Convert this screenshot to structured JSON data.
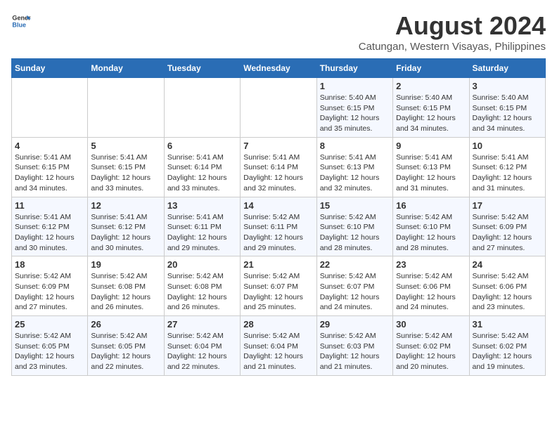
{
  "header": {
    "logo_general": "General",
    "logo_blue": "Blue",
    "title": "August 2024",
    "subtitle": "Catungan, Western Visayas, Philippines"
  },
  "calendar": {
    "days_of_week": [
      "Sunday",
      "Monday",
      "Tuesday",
      "Wednesday",
      "Thursday",
      "Friday",
      "Saturday"
    ],
    "weeks": [
      [
        {
          "day": "",
          "info": ""
        },
        {
          "day": "",
          "info": ""
        },
        {
          "day": "",
          "info": ""
        },
        {
          "day": "",
          "info": ""
        },
        {
          "day": "1",
          "info": "Sunrise: 5:40 AM\nSunset: 6:15 PM\nDaylight: 12 hours\nand 35 minutes."
        },
        {
          "day": "2",
          "info": "Sunrise: 5:40 AM\nSunset: 6:15 PM\nDaylight: 12 hours\nand 34 minutes."
        },
        {
          "day": "3",
          "info": "Sunrise: 5:40 AM\nSunset: 6:15 PM\nDaylight: 12 hours\nand 34 minutes."
        }
      ],
      [
        {
          "day": "4",
          "info": "Sunrise: 5:41 AM\nSunset: 6:15 PM\nDaylight: 12 hours\nand 34 minutes."
        },
        {
          "day": "5",
          "info": "Sunrise: 5:41 AM\nSunset: 6:15 PM\nDaylight: 12 hours\nand 33 minutes."
        },
        {
          "day": "6",
          "info": "Sunrise: 5:41 AM\nSunset: 6:14 PM\nDaylight: 12 hours\nand 33 minutes."
        },
        {
          "day": "7",
          "info": "Sunrise: 5:41 AM\nSunset: 6:14 PM\nDaylight: 12 hours\nand 32 minutes."
        },
        {
          "day": "8",
          "info": "Sunrise: 5:41 AM\nSunset: 6:13 PM\nDaylight: 12 hours\nand 32 minutes."
        },
        {
          "day": "9",
          "info": "Sunrise: 5:41 AM\nSunset: 6:13 PM\nDaylight: 12 hours\nand 31 minutes."
        },
        {
          "day": "10",
          "info": "Sunrise: 5:41 AM\nSunset: 6:12 PM\nDaylight: 12 hours\nand 31 minutes."
        }
      ],
      [
        {
          "day": "11",
          "info": "Sunrise: 5:41 AM\nSunset: 6:12 PM\nDaylight: 12 hours\nand 30 minutes."
        },
        {
          "day": "12",
          "info": "Sunrise: 5:41 AM\nSunset: 6:12 PM\nDaylight: 12 hours\nand 30 minutes."
        },
        {
          "day": "13",
          "info": "Sunrise: 5:41 AM\nSunset: 6:11 PM\nDaylight: 12 hours\nand 29 minutes."
        },
        {
          "day": "14",
          "info": "Sunrise: 5:42 AM\nSunset: 6:11 PM\nDaylight: 12 hours\nand 29 minutes."
        },
        {
          "day": "15",
          "info": "Sunrise: 5:42 AM\nSunset: 6:10 PM\nDaylight: 12 hours\nand 28 minutes."
        },
        {
          "day": "16",
          "info": "Sunrise: 5:42 AM\nSunset: 6:10 PM\nDaylight: 12 hours\nand 28 minutes."
        },
        {
          "day": "17",
          "info": "Sunrise: 5:42 AM\nSunset: 6:09 PM\nDaylight: 12 hours\nand 27 minutes."
        }
      ],
      [
        {
          "day": "18",
          "info": "Sunrise: 5:42 AM\nSunset: 6:09 PM\nDaylight: 12 hours\nand 27 minutes."
        },
        {
          "day": "19",
          "info": "Sunrise: 5:42 AM\nSunset: 6:08 PM\nDaylight: 12 hours\nand 26 minutes."
        },
        {
          "day": "20",
          "info": "Sunrise: 5:42 AM\nSunset: 6:08 PM\nDaylight: 12 hours\nand 26 minutes."
        },
        {
          "day": "21",
          "info": "Sunrise: 5:42 AM\nSunset: 6:07 PM\nDaylight: 12 hours\nand 25 minutes."
        },
        {
          "day": "22",
          "info": "Sunrise: 5:42 AM\nSunset: 6:07 PM\nDaylight: 12 hours\nand 24 minutes."
        },
        {
          "day": "23",
          "info": "Sunrise: 5:42 AM\nSunset: 6:06 PM\nDaylight: 12 hours\nand 24 minutes."
        },
        {
          "day": "24",
          "info": "Sunrise: 5:42 AM\nSunset: 6:06 PM\nDaylight: 12 hours\nand 23 minutes."
        }
      ],
      [
        {
          "day": "25",
          "info": "Sunrise: 5:42 AM\nSunset: 6:05 PM\nDaylight: 12 hours\nand 23 minutes."
        },
        {
          "day": "26",
          "info": "Sunrise: 5:42 AM\nSunset: 6:05 PM\nDaylight: 12 hours\nand 22 minutes."
        },
        {
          "day": "27",
          "info": "Sunrise: 5:42 AM\nSunset: 6:04 PM\nDaylight: 12 hours\nand 22 minutes."
        },
        {
          "day": "28",
          "info": "Sunrise: 5:42 AM\nSunset: 6:04 PM\nDaylight: 12 hours\nand 21 minutes."
        },
        {
          "day": "29",
          "info": "Sunrise: 5:42 AM\nSunset: 6:03 PM\nDaylight: 12 hours\nand 21 minutes."
        },
        {
          "day": "30",
          "info": "Sunrise: 5:42 AM\nSunset: 6:02 PM\nDaylight: 12 hours\nand 20 minutes."
        },
        {
          "day": "31",
          "info": "Sunrise: 5:42 AM\nSunset: 6:02 PM\nDaylight: 12 hours\nand 19 minutes."
        }
      ]
    ]
  }
}
